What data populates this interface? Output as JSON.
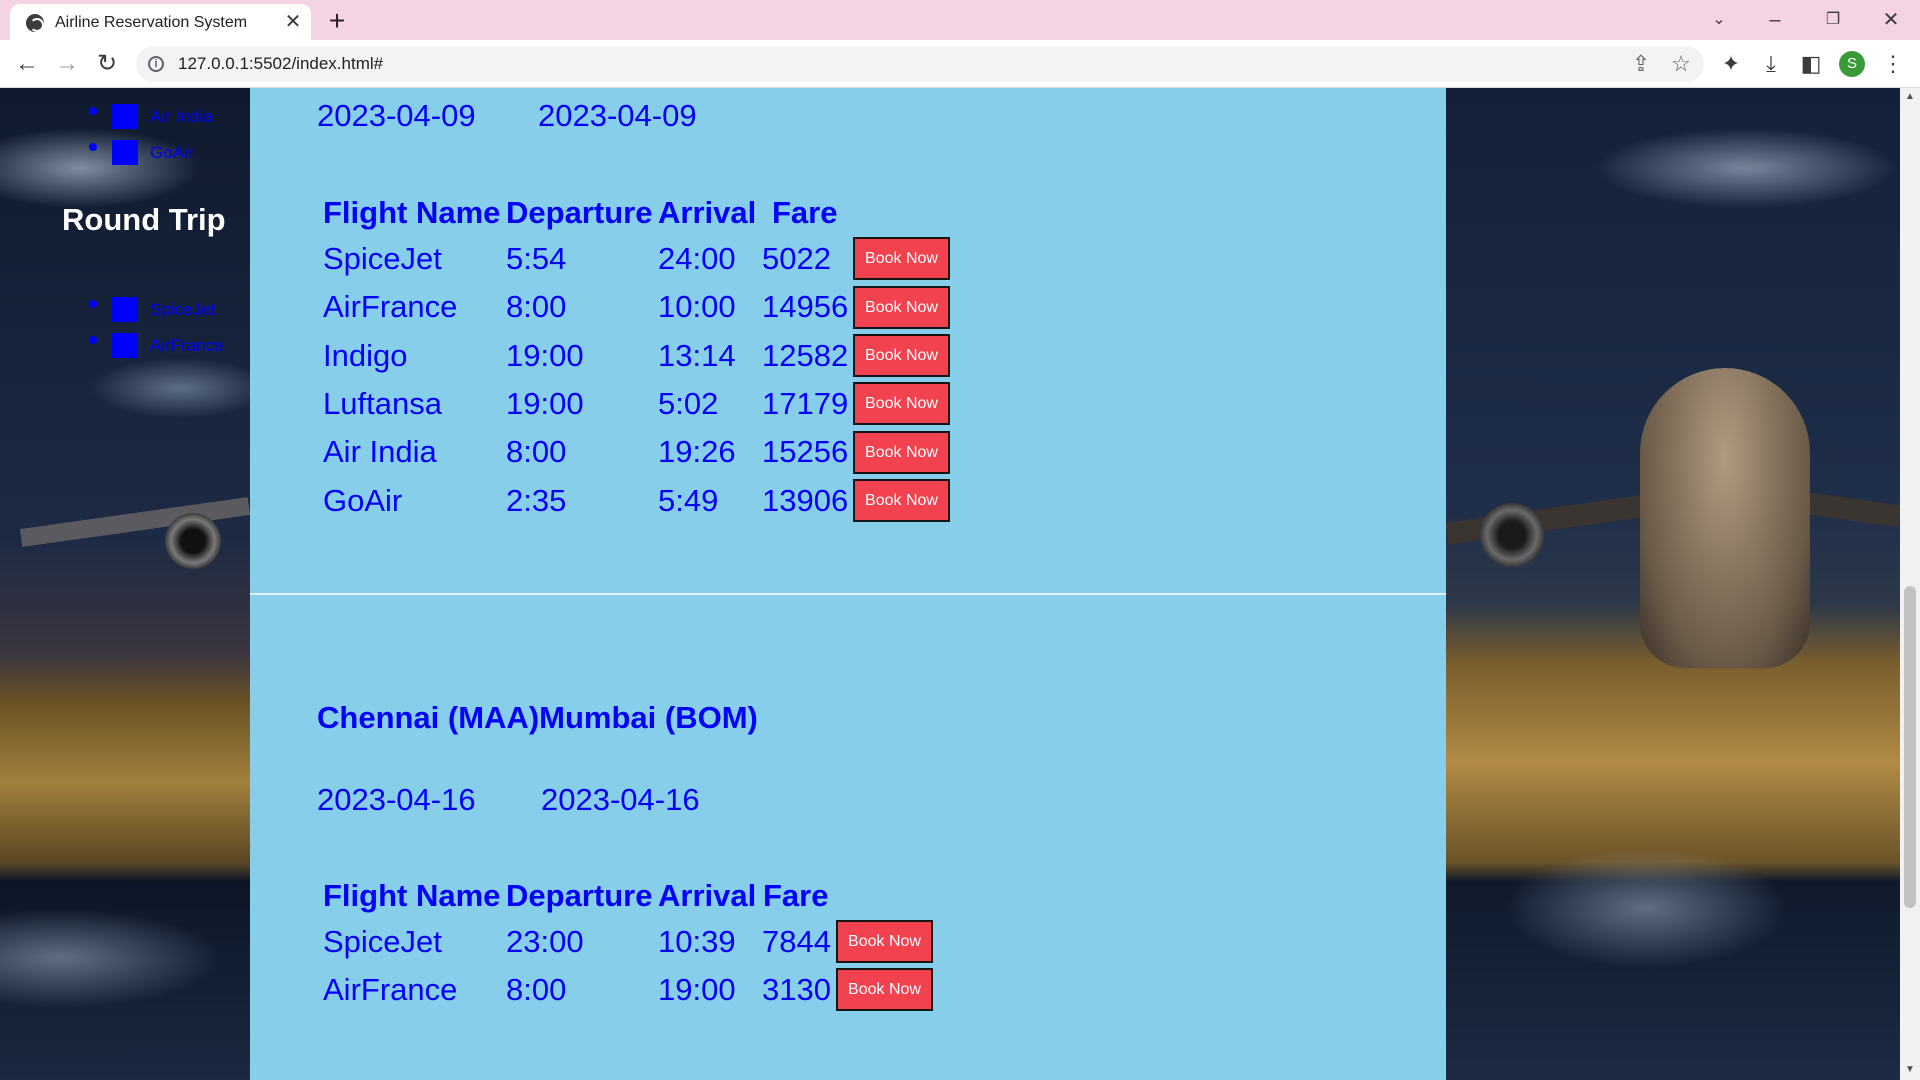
{
  "browser": {
    "tab_title": "Airline Reservation System",
    "new_tab_symbol": "+",
    "url": "127.0.0.1:5502/index.html#",
    "profile_initial": "S"
  },
  "sidebar": {
    "oneway_items": [
      "Air India",
      "GoAir"
    ],
    "roundtrip_heading": "Round Trip",
    "roundtrip_items": [
      "SpiceJet",
      "AirFrance"
    ]
  },
  "section1": {
    "dates": [
      "2023-04-09",
      "2023-04-09"
    ],
    "headers": {
      "name": "Flight Name",
      "departure": "Departure",
      "arrival": "Arrival",
      "fare": "Fare"
    },
    "flights": [
      {
        "name": "SpiceJet",
        "departure": "5:54",
        "arrival": "24:00",
        "fare": "5022"
      },
      {
        "name": "AirFrance",
        "departure": "8:00",
        "arrival": "10:00",
        "fare": "14956"
      },
      {
        "name": "Indigo",
        "departure": "19:00",
        "arrival": "13:14",
        "fare": "12582"
      },
      {
        "name": "Luftansa",
        "departure": "19:00",
        "arrival": "5:02",
        "fare": "17179"
      },
      {
        "name": "Air India",
        "departure": "8:00",
        "arrival": "19:26",
        "fare": "15256"
      },
      {
        "name": "GoAir",
        "departure": "2:35",
        "arrival": "5:49",
        "fare": "13906"
      }
    ]
  },
  "section2": {
    "route": "Chennai (MAA)Mumbai (BOM)",
    "dates": [
      "2023-04-16",
      "2023-04-16"
    ],
    "headers": {
      "name": "Flight Name",
      "departure": "Departure",
      "arrival": "Arrival",
      "fare": "Fare"
    },
    "flights": [
      {
        "name": "SpiceJet",
        "departure": "23:00",
        "arrival": "10:39",
        "fare": "7844"
      },
      {
        "name": "AirFrance",
        "departure": "8:00",
        "arrival": "19:00",
        "fare": "3130"
      }
    ]
  },
  "book_label": "Book Now",
  "colors": {
    "main_bg": "#87ceeb",
    "text_blue": "#0000ff",
    "book_button": "#f2424f"
  },
  "icons": [
    "back-icon",
    "forward-icon",
    "reload-icon",
    "share-icon",
    "star-icon",
    "extensions-icon",
    "download-icon",
    "sidepanel-icon",
    "menu-icon"
  ]
}
